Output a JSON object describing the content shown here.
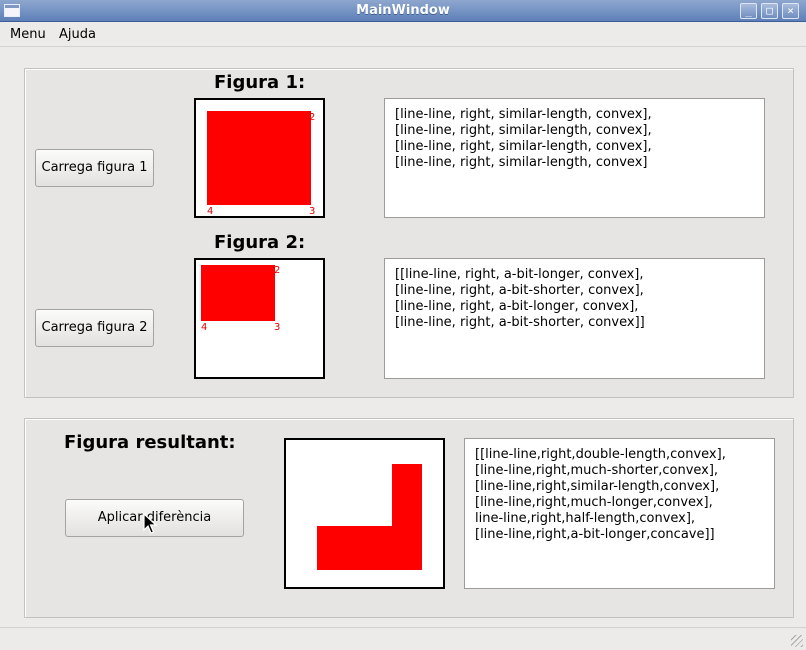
{
  "window": {
    "title": "MainWindow",
    "controls": {
      "minimize": "_",
      "maximize": "□",
      "close": "×"
    }
  },
  "menubar": {
    "items": [
      "Menu",
      "Ajuda"
    ]
  },
  "figure1": {
    "heading": "Figura 1:",
    "load_button": "Carrega figura 1",
    "vertex_labels": [
      "2",
      "4",
      "3"
    ],
    "description": [
      "[line-line, right, similar-length, convex],",
      "[line-line, right, similar-length, convex],",
      "[line-line, right, similar-length, convex],",
      "[line-line, right, similar-length, convex]"
    ]
  },
  "figure2": {
    "heading": "Figura 2:",
    "load_button": "Carrega figura 2",
    "vertex_labels": [
      "2",
      "4",
      "3"
    ],
    "description": [
      "[[line-line, right, a-bit-longer, convex],",
      "[line-line, right, a-bit-shorter, convex],",
      "[line-line, right, a-bit-longer, convex],",
      "[line-line, right, a-bit-shorter, convex]]"
    ]
  },
  "result": {
    "heading": "Figura resultant:",
    "apply_button": "Aplicar diferència",
    "description": [
      "[[line-line,right,double-length,convex],",
      "[line-line,right,much-shorter,convex],",
      "[line-line,right,similar-length,convex],",
      "[line-line,right,much-longer,convex],",
      "line-line,right,half-length,convex],",
      "[line-line,right,a-bit-longer,concave]]"
    ]
  },
  "colors": {
    "shape_fill": "#ff0000",
    "vertex_label": "#e00000",
    "titlebar": "#6f8dc0"
  },
  "icons": {
    "app": "window-icon",
    "cursor": "mouse-pointer-icon",
    "grip": "resize-grip-icon"
  }
}
